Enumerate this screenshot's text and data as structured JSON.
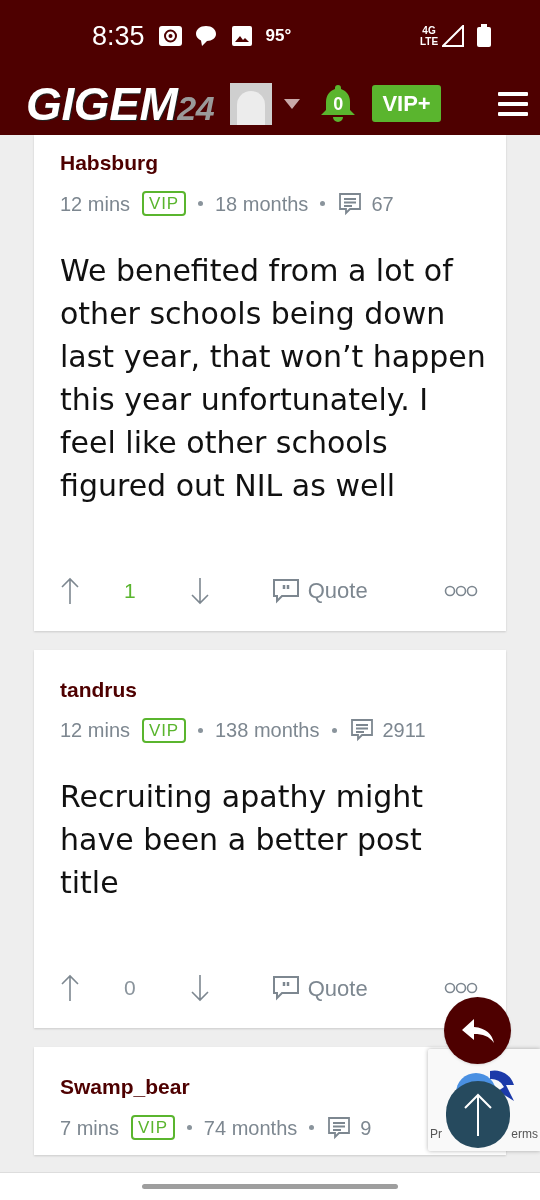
{
  "status_bar": {
    "time": "8:35",
    "temperature": "95°",
    "network": "4G LTE"
  },
  "header": {
    "logo_main": "GIGEM",
    "logo_suffix": "24",
    "notifications": "0",
    "vip_button": "VIP+"
  },
  "posts": [
    {
      "author": "Habsburg",
      "time": "12 mins",
      "badge": "VIP",
      "tenure": "18 months",
      "post_count": "67",
      "body": "We benefited from a lot of other schools being down last year, that won’t happen this year unfortunately. I feel like other schools figured out NIL as well",
      "score": "1",
      "positive": true,
      "quote": "Quote"
    },
    {
      "author": "tandrus",
      "time": "12 mins",
      "badge": "VIP",
      "tenure": "138 months",
      "post_count": "2911",
      "body": "Recruiting apathy might have been a better post title",
      "score": "0",
      "positive": false,
      "quote": "Quote"
    },
    {
      "author": "Swamp_bear",
      "time": "7 mins",
      "badge": "VIP",
      "tenure": "74 months",
      "post_count": "9"
    }
  ],
  "recaptcha": {
    "text_left": "Pr",
    "text_right": "erms"
  }
}
